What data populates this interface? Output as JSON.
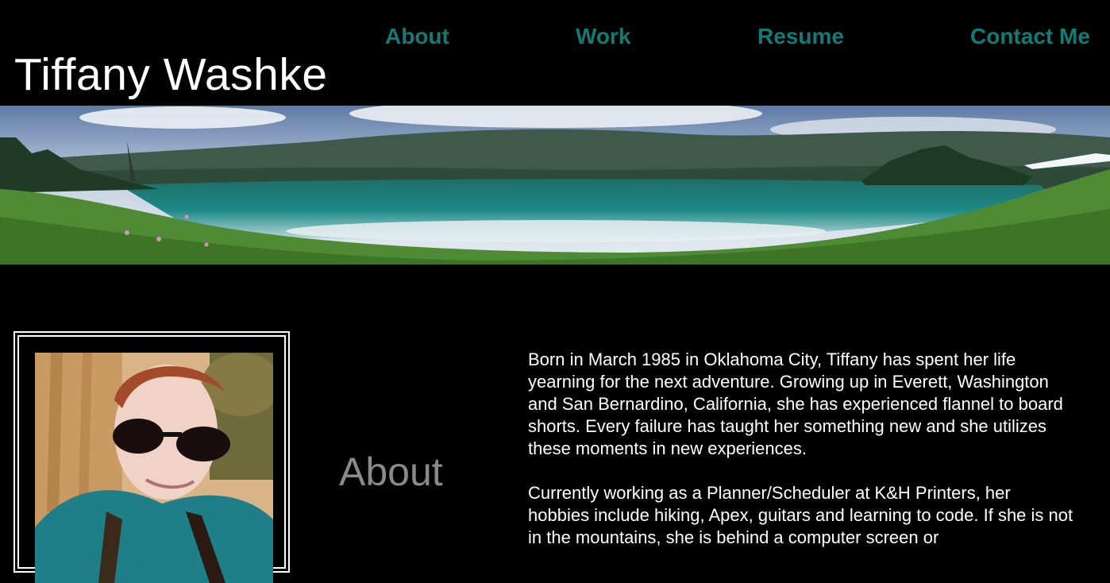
{
  "header": {
    "site_title": "Tiffany Washke",
    "nav": [
      {
        "label": "About"
      },
      {
        "label": "Work"
      },
      {
        "label": "Resume"
      },
      {
        "label": "Contact Me"
      }
    ],
    "nav_color": "#157a76"
  },
  "about": {
    "heading": "About",
    "paragraphs": [
      "Born in March 1985 in Oklahoma City, Tiffany has spent her life yearning for the next adventure. Growing up in Everett, Washington and San Bernardino, California, she has experienced flannel to board shorts. Every failure has taught her something new and she utilizes these moments in new experiences.",
      "Currently working as a Planner/Scheduler at K&H Printers, her hobbies include hiking, Apex, guitars and learning to code. If she is not in the mountains, she is behind a computer screen or"
    ]
  }
}
